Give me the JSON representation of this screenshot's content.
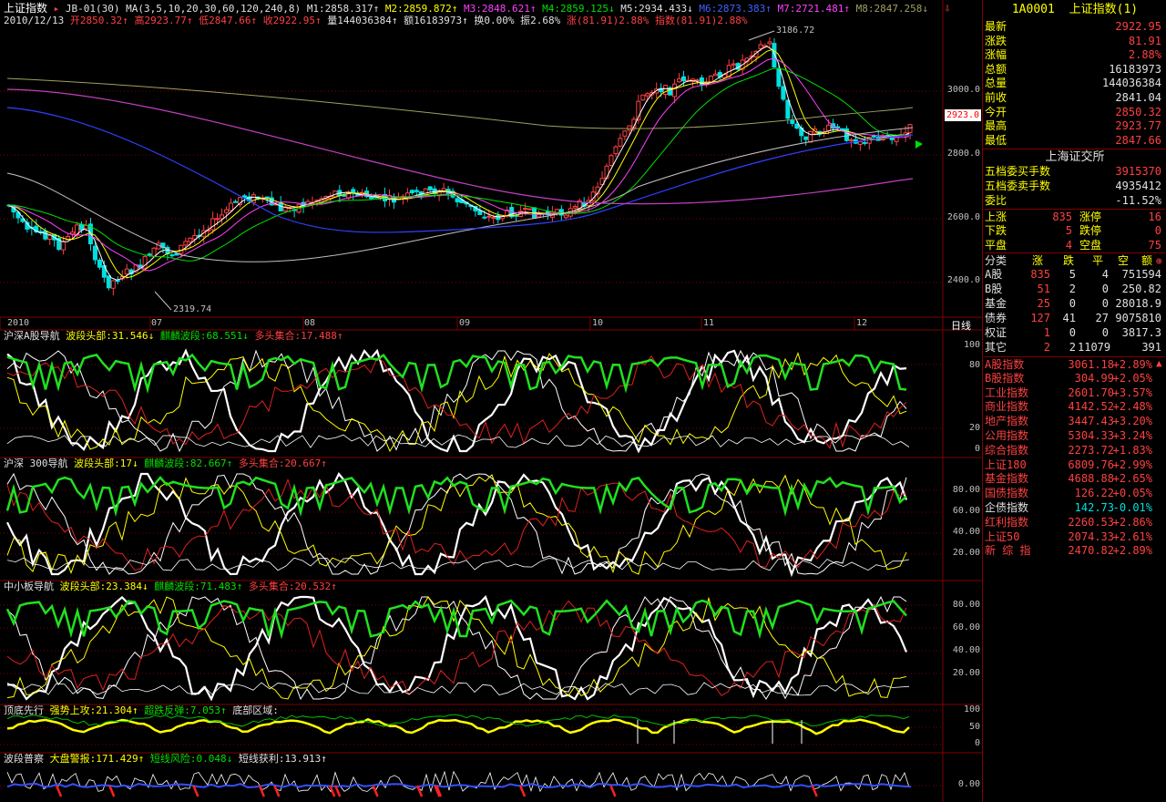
{
  "header": {
    "title": "上证指数",
    "jb": "JB-01(30)",
    "ma_label": "MA(3,5,10,20,30,60,120,240,8)",
    "m1": "M1:2858.317↑",
    "m2": "M2:2859.872↑",
    "m3": "M3:2848.621↑",
    "m4": "M4:2859.125↓",
    "m5": "M5:2934.433↓",
    "m6": "M6:2873.383↑",
    "m7": "M7:2721.481↑",
    "m8": "M8:2847.258↓",
    "date": "2010/12/13",
    "open": "开2850.32↑",
    "high": "高2923.77↑",
    "low": "低2847.66↑",
    "close": "收2922.95↑",
    "vol": "量144036384↑",
    "amount": "额16183973↑",
    "turnover": "换0.00%",
    "amp": "振2.68%",
    "rise": "涨(81.91)2.88%",
    "index_chg": "指数(81.91)2.88%"
  },
  "main_chart": {
    "price_labels": [
      "3000.0",
      "2800.0",
      "2600.0",
      "2400.0"
    ],
    "current_price": "2923.0",
    "high_mark": "3186.72",
    "low_mark": "2319.74",
    "date_axis": [
      "2010",
      "07",
      "08",
      "09",
      "10",
      "11",
      "12"
    ],
    "period": "日线"
  },
  "panels": [
    {
      "name": "沪深A股导航",
      "t1": "波段头部:31.546↓",
      "t2": "麒麟波段:68.551↓",
      "t3": "多头集合:17.488↑",
      "axis": [
        "100",
        "80",
        "20",
        "0"
      ]
    },
    {
      "name": "沪深 300导航",
      "t1": "波段头部:17↓",
      "t2": "麒麟波段:82.667↑",
      "t3": "多头集合:20.667↑",
      "axis": [
        "80.00",
        "60.00",
        "40.00",
        "20.00"
      ]
    },
    {
      "name": "中小板导航",
      "t1": "波段头部:23.384↓",
      "t2": "麒麟波段:71.483↑",
      "t3": "多头集合:20.532↑",
      "axis": [
        "80.00",
        "60.00",
        "40.00",
        "20.00"
      ]
    },
    {
      "name": "顶底先行",
      "t1": "强势上攻:21.304↑",
      "t2": "超跌反弹:7.053↑",
      "t3": "底部区域:",
      "axis": [
        "100",
        "50",
        "0"
      ]
    },
    {
      "name": "波段普察",
      "t1": "大盘警报:171.429↑",
      "t2": "短线风险:0.048↓",
      "t3": "短线获利:13.913↑",
      "axis": [
        "0.00"
      ]
    }
  ],
  "sidebar": {
    "code": "1A0001",
    "name": "上证指数(1)",
    "quote": [
      {
        "k": "最新",
        "v": "2922.95",
        "c": "red"
      },
      {
        "k": "涨跌",
        "v": "81.91",
        "c": "red"
      },
      {
        "k": "涨幅",
        "v": "2.88%",
        "c": "red"
      },
      {
        "k": "总额",
        "v": "16183973",
        "c": "wht"
      },
      {
        "k": "总量",
        "v": "144036384",
        "c": "wht"
      },
      {
        "k": "前收",
        "v": "2841.04",
        "c": "wht"
      },
      {
        "k": "今开",
        "v": "2850.32",
        "c": "red"
      },
      {
        "k": "最高",
        "v": "2923.77",
        "c": "red"
      },
      {
        "k": "最低",
        "v": "2847.66",
        "c": "red"
      }
    ],
    "exchange": "上海证交所",
    "orders": [
      {
        "k": "五档委买手数",
        "v": "3915370",
        "c": "red"
      },
      {
        "k": "五档委卖手数",
        "v": "4935412",
        "c": "wht"
      },
      {
        "k": "委比",
        "v": "-11.52%",
        "c": "wht"
      }
    ],
    "breadth": [
      {
        "k1": "上涨",
        "v1": "835",
        "k2": "涨停",
        "v2": "16"
      },
      {
        "k1": "下跌",
        "v1": "5",
        "k2": "跌停",
        "v2": "0"
      },
      {
        "k1": "平盘",
        "v1": "4",
        "k2": "空盘",
        "v2": "75"
      }
    ],
    "class_header": [
      "分类",
      "涨",
      "跌",
      "平",
      "空",
      "额"
    ],
    "classes": [
      {
        "k": "A股",
        "a": "835",
        "b": "5",
        "c": "4",
        "d": "751594"
      },
      {
        "k": "B股",
        "a": "51",
        "b": "2",
        "c": "0",
        "d": "250.82"
      },
      {
        "k": "基金",
        "a": "25",
        "b": "0",
        "c": "0",
        "d": "28018.9"
      },
      {
        "k": "债券",
        "a": "127",
        "b": "41",
        "c": "27",
        "d": "9075810"
      },
      {
        "k": "权证",
        "a": "1",
        "b": "0",
        "c": "0",
        "d": "3817.3"
      },
      {
        "k": "其它",
        "a": "2",
        "b": "2",
        "c": "11079",
        "d": "391"
      }
    ],
    "indices": [
      {
        "k": "A股指数",
        "v": "3061.18",
        "p": "+2.89%",
        "c": "red"
      },
      {
        "k": "B股指数",
        "v": "304.99",
        "p": "+2.05%",
        "c": "red"
      },
      {
        "k": "工业指数",
        "v": "2601.70",
        "p": "+3.57%",
        "c": "red"
      },
      {
        "k": "商业指数",
        "v": "4142.52",
        "p": "+2.48%",
        "c": "red"
      },
      {
        "k": "地产指数",
        "v": "3447.43",
        "p": "+3.20%",
        "c": "red"
      },
      {
        "k": "公用指数",
        "v": "5304.33",
        "p": "+3.24%",
        "c": "red"
      },
      {
        "k": "综合指数",
        "v": "2273.72",
        "p": "+1.83%",
        "c": "red"
      },
      {
        "k": "上证180",
        "v": "6809.76",
        "p": "+2.99%",
        "c": "red"
      },
      {
        "k": "基金指数",
        "v": "4688.88",
        "p": "+2.65%",
        "c": "red"
      },
      {
        "k": "国债指数",
        "v": "126.22",
        "p": "+0.05%",
        "c": "red"
      },
      {
        "k": "企债指数",
        "v": "142.73",
        "p": "-0.01%",
        "c": "cyan"
      },
      {
        "k": "红利指数",
        "v": "2260.53",
        "p": "+2.86%",
        "c": "red"
      },
      {
        "k": "上证50",
        "v": "2074.33",
        "p": "+2.61%",
        "c": "red"
      },
      {
        "k": "新 综 指",
        "v": "2470.82",
        "p": "+2.89%",
        "c": "red"
      }
    ]
  },
  "colors": {
    "up": "#ff4040",
    "down": "#00e0e0",
    "grid": "#800000",
    "green": "#00e000",
    "yellow": "#ffff00"
  }
}
